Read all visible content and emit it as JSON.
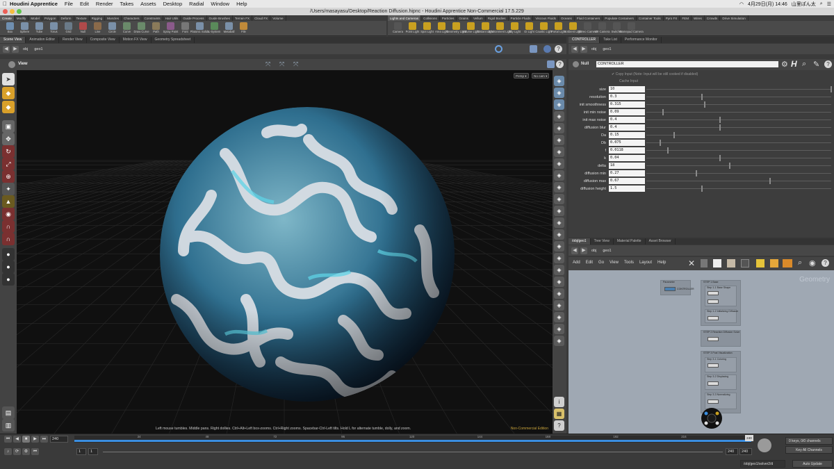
{
  "menubar": {
    "app": "Houdini Apprentice",
    "items": [
      "File",
      "Edit",
      "Render",
      "Takes",
      "Assets",
      "Desktop",
      "Radial",
      "Window",
      "Help"
    ],
    "clock": "4月29日(月)  14:46",
    "user": "山里ぽん太"
  },
  "window": {
    "title": "/Users/masayasu/Desktop/Reaction Diffusion.hipnc - Houdini Apprentice Non-Commercial 17.5.229"
  },
  "shelf_left": {
    "tabs": [
      "Create",
      "Modify",
      "Model",
      "Polygon",
      "Deform",
      "Texture",
      "Rigging",
      "Muscles",
      "Characters",
      "Constraints",
      "Hair Utils",
      "Guide Process",
      "Guide Brushes",
      "Terrain FX",
      "Cloud FX",
      "Volume"
    ],
    "tools": [
      {
        "label": "Box",
        "icon": "box-icon",
        "color": "#6f8fb0"
      },
      {
        "label": "Sphere",
        "icon": "sphere-icon",
        "color": "#7a90a8"
      },
      {
        "label": "Tube",
        "icon": "tube-icon",
        "color": "#7a90a8"
      },
      {
        "label": "Torus",
        "icon": "torus-icon",
        "color": "#7a90a8"
      },
      {
        "label": "Grid",
        "icon": "grid-icon",
        "color": "#6a7a88"
      },
      {
        "label": "Null",
        "icon": "null-icon",
        "color": "#b04a4a"
      },
      {
        "label": "Line",
        "icon": "line-icon",
        "color": "#8a6a4a"
      },
      {
        "label": "Circle",
        "icon": "circle-icon",
        "color": "#7a90a8"
      },
      {
        "label": "Curve",
        "icon": "curve-icon",
        "color": "#6a8a6a"
      },
      {
        "label": "Draw Curve",
        "icon": "draw-curve-icon",
        "color": "#6a8a6a"
      },
      {
        "label": "Path",
        "icon": "path-icon",
        "color": "#8a7a5a"
      },
      {
        "label": "Spray Paint",
        "icon": "spray-paint-icon",
        "color": "#8a5a8a"
      },
      {
        "label": "Font",
        "icon": "font-icon",
        "color": "#777"
      },
      {
        "label": "Platonic Solids",
        "icon": "platonic-icon",
        "color": "#7a90a8"
      },
      {
        "label": "L-System",
        "icon": "lsystem-icon",
        "color": "#5a8a5a"
      },
      {
        "label": "Metaball",
        "icon": "metaball-icon",
        "color": "#7a90a8"
      },
      {
        "label": "File",
        "icon": "file-icon",
        "color": "#c08a3a"
      }
    ]
  },
  "shelf_right": {
    "tabs": [
      "Lights and Cameras",
      "Collisions",
      "Particles",
      "Grains",
      "Vellum",
      "Rigid Bodies",
      "Particle Fluids",
      "Viscous Fluids",
      "Oceans",
      "Fluid Containers",
      "Populate Containers",
      "Container Tools",
      "Pyro FX",
      "FEM",
      "Wires",
      "Crowds",
      "Drive Simulation"
    ],
    "tools": [
      {
        "label": "Camera",
        "icon": "camera-icon",
        "color": "#555"
      },
      {
        "label": "Point Light",
        "icon": "point-light-icon",
        "color": "#c9a020"
      },
      {
        "label": "Spot Light",
        "icon": "spot-light-icon",
        "color": "#c9a020"
      },
      {
        "label": "Area Light",
        "icon": "area-light-icon",
        "color": "#c9a020"
      },
      {
        "label": "Geometry Light",
        "icon": "geometry-light-icon",
        "color": "#c9a020"
      },
      {
        "label": "Volume Light",
        "icon": "volume-light-icon",
        "color": "#c9a020"
      },
      {
        "label": "Distant Light",
        "icon": "distant-light-icon",
        "color": "#c9a020"
      },
      {
        "label": "Environment Light",
        "icon": "environment-light-icon",
        "color": "#c9a020"
      },
      {
        "label": "Sky Light",
        "icon": "sky-light-icon",
        "color": "#c9a020"
      },
      {
        "label": "GI Light",
        "icon": "gi-light-icon",
        "color": "#c9a020"
      },
      {
        "label": "Caustic Light",
        "icon": "caustic-light-icon",
        "color": "#c9a020"
      },
      {
        "label": "Portal Light",
        "icon": "portal-light-icon",
        "color": "#c9a020"
      },
      {
        "label": "Ambient Light",
        "icon": "ambient-light-icon",
        "color": "#c9a020"
      },
      {
        "label": "Stereo Camera",
        "icon": "stereo-camera-icon",
        "color": "#555"
      },
      {
        "label": "VR Camera",
        "icon": "vr-camera-icon",
        "color": "#555"
      },
      {
        "label": "Switcher",
        "icon": "switcher-icon",
        "color": "#555"
      },
      {
        "label": "Gamepad Camera",
        "icon": "gamepad-camera-icon",
        "color": "#555"
      }
    ]
  },
  "left_pane": {
    "tabs": [
      "Scene View",
      "Animation Editor",
      "Render View",
      "Composite View",
      "Motion FX View",
      "Geometry Spreadsheet"
    ],
    "path": [
      "obj",
      "geo1"
    ],
    "view_label": "View",
    "persp": "Persp",
    "cam": "No cam",
    "status": "Left mouse tumbles. Middle pans. Right dollies. Ctrl+Alt+Left box-zooms. Ctrl+Right zooms. Spacebar-Ctrl-Left tilts. Hold L for alternate tumble, dolly, and zoom.",
    "noncommercial": "Non-Commercial Edition"
  },
  "param_pane": {
    "tabs": [
      "CONTROLLER",
      "Take List",
      "Performance Monitor"
    ],
    "path": [
      "obj",
      "geo1"
    ],
    "node_type": "Null",
    "node_name": "CONTROLLER",
    "copy_input": "Copy Input (Note: Input will be still cooked if disabled)",
    "cache_input": "Cache Input",
    "params": [
      {
        "label": "size",
        "value": "10",
        "level": 1.0
      },
      {
        "label": "resolution",
        "value": "0.3",
        "level": 0.3
      },
      {
        "label": "init smoothness",
        "value": "0.315",
        "level": 0.315
      },
      {
        "label": "init min noise",
        "value": "0.09",
        "level": 0.09
      },
      {
        "label": "init max noise",
        "value": "0.4",
        "level": 0.4
      },
      {
        "label": "diffusion blur",
        "value": "0.4",
        "level": 0.4
      },
      {
        "label": "Da",
        "value": "0.15",
        "level": 0.15
      },
      {
        "label": "Db",
        "value": "0.075",
        "level": 0.075
      },
      {
        "label": "f",
        "value": "0.0118",
        "level": 0.118
      },
      {
        "label": "k",
        "value": "0.04",
        "level": 0.4
      },
      {
        "label": "delta",
        "value": "18",
        "level": 0.45
      },
      {
        "label": "diffusion min",
        "value": "0.27",
        "level": 0.27
      },
      {
        "label": "diffusion max",
        "value": "0.67",
        "level": 0.67
      },
      {
        "label": "diffusion height",
        "value": "1.5",
        "level": 0.3
      }
    ]
  },
  "network_pane": {
    "tabs": [
      "/obj/geo1",
      "Tree View",
      "Material Palette",
      "Asset Browser"
    ],
    "path": [
      "obj",
      "geo1"
    ],
    "menu": [
      "Add",
      "Edit",
      "Go",
      "View",
      "Tools",
      "Layout",
      "Help"
    ],
    "watermark": "Geometry",
    "boxes": [
      "Parameter",
      "STEP 1 Base",
      "STEP 2 Reaction Diffusion Solve",
      "STEP 3 Post Visualization"
    ],
    "node_labels": [
      "CONTROLLER",
      "Step 1-1 Base Shape",
      "Step 1-2 Initializing Diffusion",
      "Step 3-1 Coloring",
      "Step 3-2 Displacing",
      "Step 3-3 Normalizing"
    ]
  },
  "timeline": {
    "frame": "240",
    "start": "1",
    "start2": "1",
    "end": "240",
    "end2": "240",
    "ticks": [
      "24",
      "48",
      "72",
      "96",
      "120",
      "144",
      "168",
      "192",
      "216"
    ],
    "current_marker": "240",
    "keys": "0 keys, 0/0 channels",
    "key_all": "Key All Channels",
    "path": "/obj/geo1/solver2/d",
    "auto_update": "Auto Update"
  },
  "colors": {
    "accent_blue": "#3a8ee0",
    "viewport_bg": "#101010",
    "network_bg": "#9fa8b3"
  }
}
